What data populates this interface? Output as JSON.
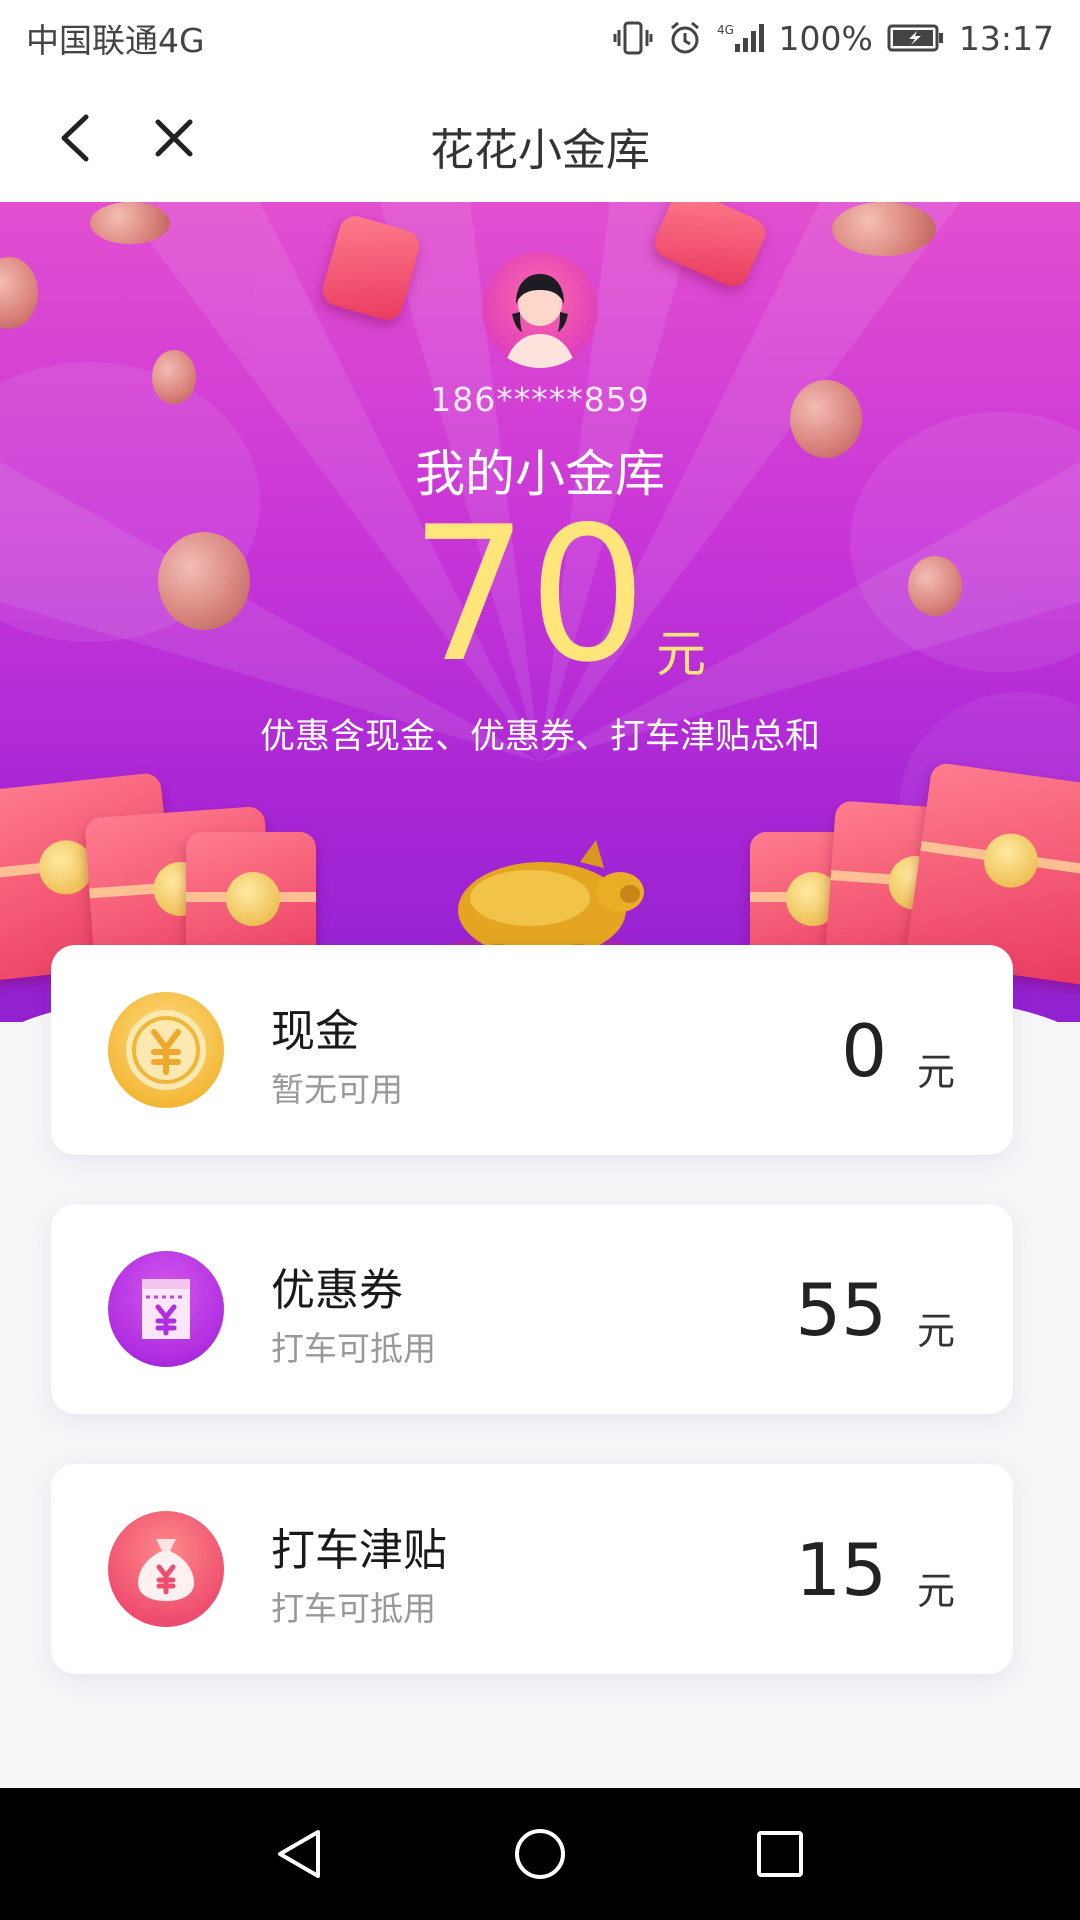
{
  "status_bar": {
    "carrier": "中国联通4G",
    "battery": "100%",
    "time": "13:17",
    "network": "4G"
  },
  "nav": {
    "title": "花花小金库"
  },
  "hero": {
    "phone": "186*****859",
    "label": "我的小金库",
    "amount": "70",
    "unit": "元",
    "description": "优惠含现金、优惠券、打车津贴总和"
  },
  "cards": [
    {
      "title": "现金",
      "subtitle": "暂无可用",
      "value": "0",
      "unit": "元",
      "icon": "yen-coin-icon"
    },
    {
      "title": "优惠券",
      "subtitle": "打车可抵用",
      "value": "55",
      "unit": "元",
      "icon": "coupon-icon"
    },
    {
      "title": "打车津贴",
      "subtitle": "打车可抵用",
      "value": "15",
      "unit": "元",
      "icon": "money-bag-icon"
    }
  ],
  "colors": {
    "hero_top": "#e24fd0",
    "hero_bottom": "#9121d0",
    "amount": "#ffe57a",
    "cash_icon": "#f4b93a",
    "coupon_icon": "#b02ee0",
    "subsidy_icon": "#ef4f6e"
  }
}
